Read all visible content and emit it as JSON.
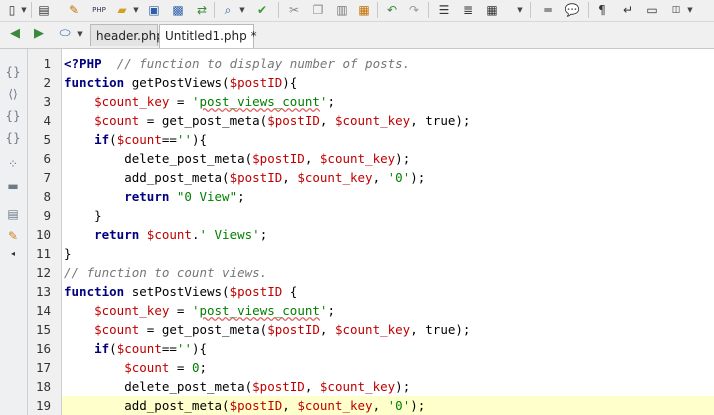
{
  "toolbar": {
    "icons": [
      "new-file-icon",
      "php-file-icon",
      "edit-icon",
      "php-icon",
      "open-folder-icon",
      "save-icon",
      "save-all-icon",
      "sync-icon",
      "find-icon",
      "check-icon",
      "cut-icon",
      "copy-icon",
      "paste-icon",
      "paste-special-icon",
      "undo-icon",
      "redo-icon",
      "align-left-icon",
      "list-icon",
      "table-icon",
      "hr-icon",
      "comment-icon",
      "paragraph-icon",
      "line-break-icon",
      "tag-icon",
      "more-icon"
    ]
  },
  "tabs": [
    {
      "label": "header.php",
      "active": false
    },
    {
      "label": "Untitled1.php *",
      "active": true
    }
  ],
  "line_numbers": [
    "1",
    "2",
    "3",
    "4",
    "5",
    "6",
    "7",
    "8",
    "9",
    "10",
    "11",
    "12",
    "13",
    "14",
    "15",
    "16",
    "17",
    "18",
    "19"
  ],
  "highlighted_line": 19,
  "code_lines": [
    [
      [
        "php",
        "<?PHP"
      ],
      [
        "",
        "  "
      ],
      [
        "cm",
        "// function to display number of posts."
      ]
    ],
    [
      [
        "kw",
        "function"
      ],
      [
        "",
        " getPostViews("
      ],
      [
        "var",
        "$postID"
      ],
      [
        "",
        "){"
      ]
    ],
    [
      [
        "",
        "    "
      ],
      [
        "var",
        "$count_key"
      ],
      [
        "",
        " = "
      ],
      [
        "str",
        "'"
      ],
      [
        "str sq",
        "post_views_count"
      ],
      [
        "str",
        "'"
      ],
      [
        "",
        ";"
      ]
    ],
    [
      [
        "",
        "    "
      ],
      [
        "var",
        "$count"
      ],
      [
        "",
        " = get_post_meta("
      ],
      [
        "var",
        "$postID"
      ],
      [
        "",
        ", "
      ],
      [
        "var",
        "$count_key"
      ],
      [
        "",
        ", true);"
      ]
    ],
    [
      [
        "",
        "    "
      ],
      [
        "kw",
        "if"
      ],
      [
        "",
        "("
      ],
      [
        "var",
        "$count"
      ],
      [
        "",
        "=="
      ],
      [
        "str",
        "''"
      ],
      [
        "",
        "){"
      ]
    ],
    [
      [
        "",
        "        delete_post_meta("
      ],
      [
        "var",
        "$postID"
      ],
      [
        "",
        ", "
      ],
      [
        "var",
        "$count_key"
      ],
      [
        "",
        ");"
      ]
    ],
    [
      [
        "",
        "        add_post_meta("
      ],
      [
        "var",
        "$postID"
      ],
      [
        "",
        ", "
      ],
      [
        "var",
        "$count_key"
      ],
      [
        "",
        ", "
      ],
      [
        "str",
        "'0'"
      ],
      [
        "",
        ");"
      ]
    ],
    [
      [
        "",
        "        "
      ],
      [
        "kw",
        "return"
      ],
      [
        "",
        " "
      ],
      [
        "str",
        "\"0 View\""
      ],
      [
        "",
        ";"
      ]
    ],
    [
      [
        "",
        "    }"
      ]
    ],
    [
      [
        "",
        "    "
      ],
      [
        "kw",
        "return"
      ],
      [
        "",
        " "
      ],
      [
        "var",
        "$count"
      ],
      [
        "",
        "."
      ],
      [
        "str",
        "' Views'"
      ],
      [
        "",
        ";"
      ]
    ],
    [
      [
        "",
        "}"
      ]
    ],
    [
      [
        "cm",
        "// function to count views."
      ]
    ],
    [
      [
        "kw",
        "function"
      ],
      [
        "",
        " setPostViews("
      ],
      [
        "var",
        "$postID"
      ],
      [
        "",
        " {"
      ]
    ],
    [
      [
        "",
        "    "
      ],
      [
        "var",
        "$count_key"
      ],
      [
        "",
        " = "
      ],
      [
        "str",
        "'"
      ],
      [
        "str sq",
        "post_views_count"
      ],
      [
        "str",
        "'"
      ],
      [
        "",
        ";"
      ]
    ],
    [
      [
        "",
        "    "
      ],
      [
        "var",
        "$count"
      ],
      [
        "",
        " = get_post_meta("
      ],
      [
        "var",
        "$postID"
      ],
      [
        "",
        ", "
      ],
      [
        "var",
        "$count_key"
      ],
      [
        "",
        ", true);"
      ]
    ],
    [
      [
        "",
        "    "
      ],
      [
        "kw",
        "if"
      ],
      [
        "",
        "("
      ],
      [
        "var",
        "$count"
      ],
      [
        "",
        "=="
      ],
      [
        "str",
        "''"
      ],
      [
        "",
        "){"
      ]
    ],
    [
      [
        "",
        "        "
      ],
      [
        "var",
        "$count"
      ],
      [
        "",
        " = "
      ],
      [
        "str",
        "0"
      ],
      [
        "",
        ";"
      ]
    ],
    [
      [
        "",
        "        delete_post_meta("
      ],
      [
        "var",
        "$postID"
      ],
      [
        "",
        ", "
      ],
      [
        "var",
        "$count_key"
      ],
      [
        "",
        ");"
      ]
    ],
    [
      [
        "",
        "        add_post_meta("
      ],
      [
        "var",
        "$postID"
      ],
      [
        "",
        ", "
      ],
      [
        "var",
        "$count_key"
      ],
      [
        "",
        ", "
      ],
      [
        "str",
        "'0'"
      ],
      [
        "",
        ");"
      ]
    ]
  ],
  "colors": {
    "keyword": "#000080",
    "variable": "#c00000",
    "string": "#008000",
    "comment": "#777777",
    "current_line": "#ffffcc"
  }
}
